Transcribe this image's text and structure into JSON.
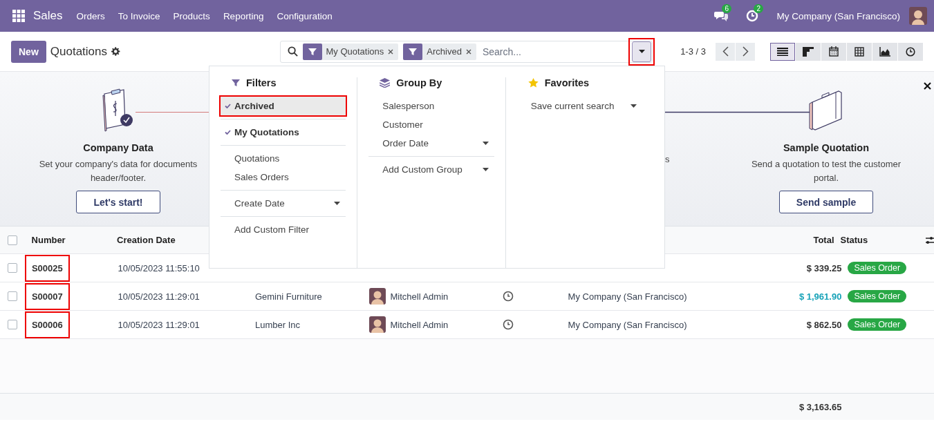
{
  "navbar": {
    "app": "Sales",
    "menus": [
      "Orders",
      "To Invoice",
      "Products",
      "Reporting",
      "Configuration"
    ],
    "messages_count": "6",
    "activities_count": "2",
    "company": "My Company (San Francisco)"
  },
  "control_panel": {
    "new_button": "New",
    "title": "Quotations",
    "facets": [
      {
        "label": "My Quotations"
      },
      {
        "label": "Archived"
      }
    ],
    "search_placeholder": "Search...",
    "toggle_highlighted": true,
    "pager": "1-3 / 3",
    "views": [
      {
        "kind": "list",
        "selected": true
      },
      {
        "kind": "kanban",
        "selected": false
      },
      {
        "kind": "calendar",
        "selected": false
      },
      {
        "kind": "pivot",
        "selected": false
      },
      {
        "kind": "graph",
        "selected": false
      },
      {
        "kind": "activity",
        "selected": false
      }
    ]
  },
  "dropdown": {
    "filters": {
      "title": "Filters",
      "groups": [
        {
          "items": [
            {
              "label": "Archived",
              "checked": true,
              "highlighted": true,
              "caret": false
            }
          ]
        },
        {
          "items": [
            {
              "label": "My Quotations",
              "checked": true,
              "highlighted": false,
              "caret": false
            }
          ]
        },
        {
          "items": [
            {
              "label": "Quotations",
              "checked": false,
              "highlighted": false,
              "caret": false
            },
            {
              "label": "Sales Orders",
              "checked": false,
              "highlighted": false,
              "caret": false
            }
          ]
        },
        {
          "items": [
            {
              "label": "Create Date",
              "checked": false,
              "highlighted": false,
              "caret": true
            }
          ]
        },
        {
          "items": [
            {
              "label": "Add Custom Filter",
              "checked": false,
              "highlighted": false,
              "caret": false
            }
          ]
        }
      ]
    },
    "group_by": {
      "title": "Group By",
      "groups": [
        {
          "items": [
            {
              "label": "Salesperson",
              "checked": false,
              "highlighted": false,
              "caret": false
            },
            {
              "label": "Customer",
              "checked": false,
              "highlighted": false,
              "caret": false
            },
            {
              "label": "Order Date",
              "checked": false,
              "highlighted": false,
              "caret": true
            }
          ]
        },
        {
          "items": [
            {
              "label": "Add Custom Group",
              "checked": false,
              "highlighted": false,
              "caret": true
            }
          ]
        }
      ]
    },
    "favorites": {
      "title": "Favorites",
      "groups": [
        {
          "items": [
            {
              "label": "Save current search",
              "checked": false,
              "highlighted": false,
              "caret": true
            }
          ]
        }
      ]
    }
  },
  "banner": {
    "steps": [
      {
        "kind": "company",
        "title": "Company Data",
        "description": "Set your company's data for documents header/footer.",
        "button": "Let's start!"
      },
      {
        "kind": "sample",
        "title": "Sample Quotation",
        "description": "Send a quotation to test the customer portal.",
        "button": "Send sample"
      }
    ],
    "fragment": "s"
  },
  "table": {
    "select_all_checked": false,
    "headers": {
      "number": "Number",
      "creation_date": "Creation Date",
      "total": "Total",
      "status": "Status"
    },
    "rows": [
      {
        "number": "S00025",
        "checked": false,
        "highlighted": true,
        "creation_date": "10/05/2023 11:55:10",
        "total": "$ 339.25",
        "emphasized": false,
        "status": "Sales Order"
      },
      {
        "number": "S00007",
        "checked": false,
        "highlighted": true,
        "creation_date": "10/05/2023 11:29:01",
        "customer": "Gemini Furniture",
        "salesperson": "Mitchell Admin",
        "activity": true,
        "company": "My Company (San Francisco)",
        "total": "$ 1,961.90",
        "emphasized": true,
        "status": "Sales Order"
      },
      {
        "number": "S00006",
        "checked": false,
        "highlighted": true,
        "creation_date": "10/05/2023 11:29:01",
        "customer": "Lumber Inc",
        "salesperson": "Mitchell Admin",
        "activity": true,
        "company": "My Company (San Francisco)",
        "total": "$ 862.50",
        "emphasized": false,
        "status": "Sales Order"
      }
    ],
    "grand_total": "$ 3,163.65"
  }
}
